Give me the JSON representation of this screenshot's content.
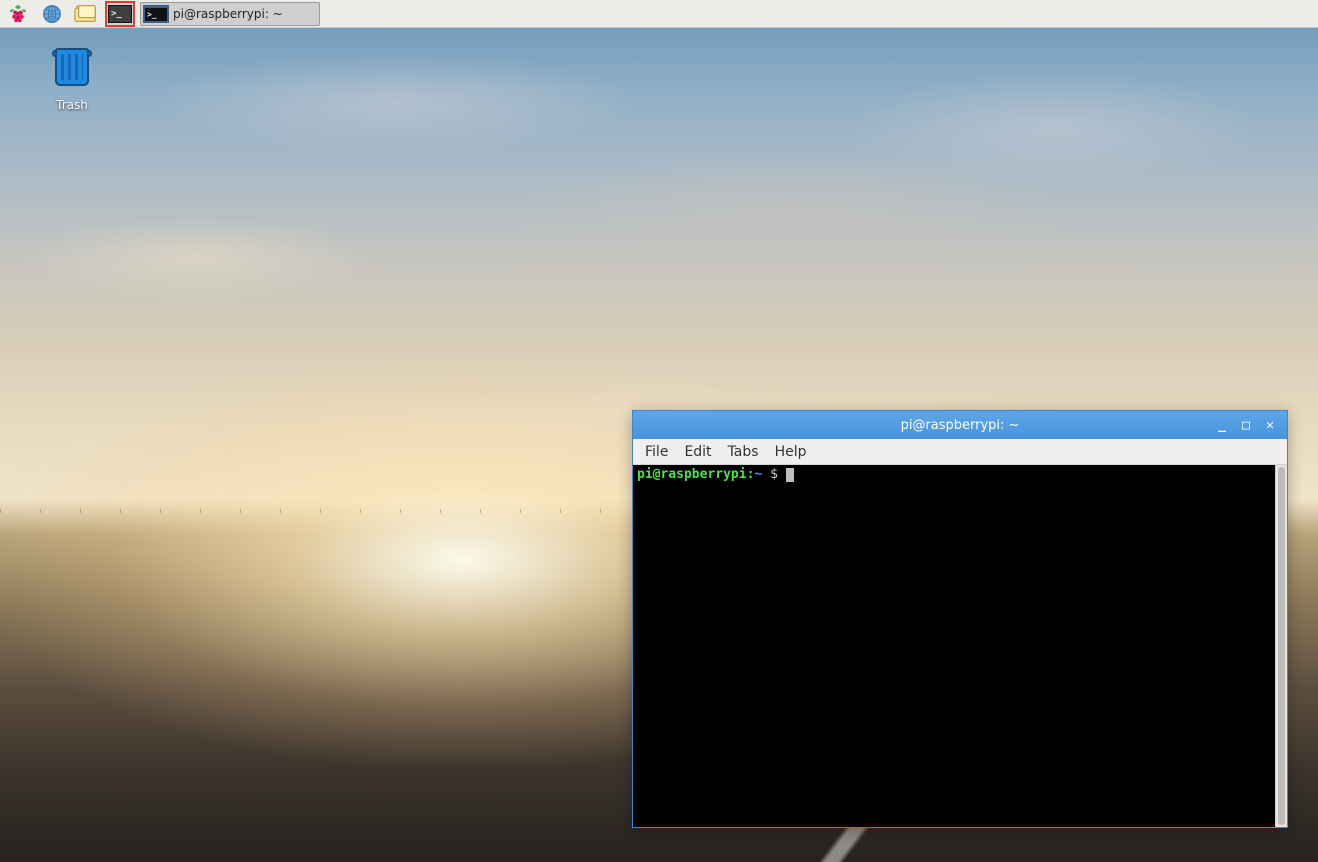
{
  "taskbar": {
    "running_app_label": "pi@raspberrypi: ~"
  },
  "desktop": {
    "trash_label": "Trash"
  },
  "terminal": {
    "title": "pi@raspberrypi: ~",
    "menus": {
      "file": "File",
      "edit": "Edit",
      "tabs": "Tabs",
      "help": "Help"
    },
    "prompt": {
      "user_host": "pi@raspberrypi",
      "colon": ":",
      "path": "~ ",
      "dollar": "$ "
    }
  }
}
